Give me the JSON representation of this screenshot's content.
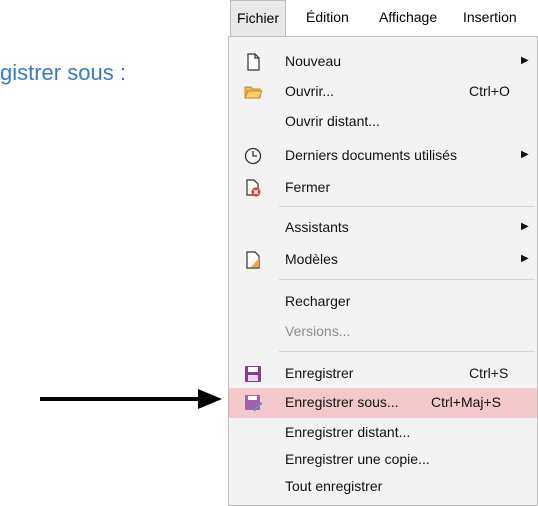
{
  "background": {
    "text": "gistrer sous :"
  },
  "menubar": {
    "items": [
      {
        "label": "Fichier",
        "active": true
      },
      {
        "label": "Édition",
        "active": false
      },
      {
        "label": "Affichage",
        "active": false
      },
      {
        "label": "Insertion",
        "active": false
      }
    ]
  },
  "menu": {
    "items": [
      {
        "label": "Nouveau",
        "icon": "new-document-icon",
        "submenu": true
      },
      {
        "label": "Ouvrir...",
        "icon": "folder-open-icon",
        "shortcut": "Ctrl+O"
      },
      {
        "label": "Ouvrir distant..."
      },
      {
        "label": "Derniers documents utilisés",
        "icon": "clock-icon",
        "submenu": true
      },
      {
        "label": "Fermer",
        "icon": "close-document-icon"
      },
      {
        "label": "Assistants",
        "submenu": true
      },
      {
        "label": "Modèles",
        "icon": "template-icon",
        "submenu": true
      },
      {
        "label": "Recharger"
      },
      {
        "label": "Versions...",
        "disabled": true
      },
      {
        "label": "Enregistrer",
        "icon": "save-icon",
        "shortcut": "Ctrl+S"
      },
      {
        "label": "Enregistrer sous...",
        "icon": "save-as-icon",
        "shortcut": "Ctrl+Maj+S",
        "highlighted": true
      },
      {
        "label": "Enregistrer distant..."
      },
      {
        "label": "Enregistrer une copie..."
      },
      {
        "label": "Tout enregistrer"
      }
    ]
  },
  "colors": {
    "highlight": "#f5c9cc",
    "background_text": "#3a79c6",
    "arrow": "#000000"
  }
}
